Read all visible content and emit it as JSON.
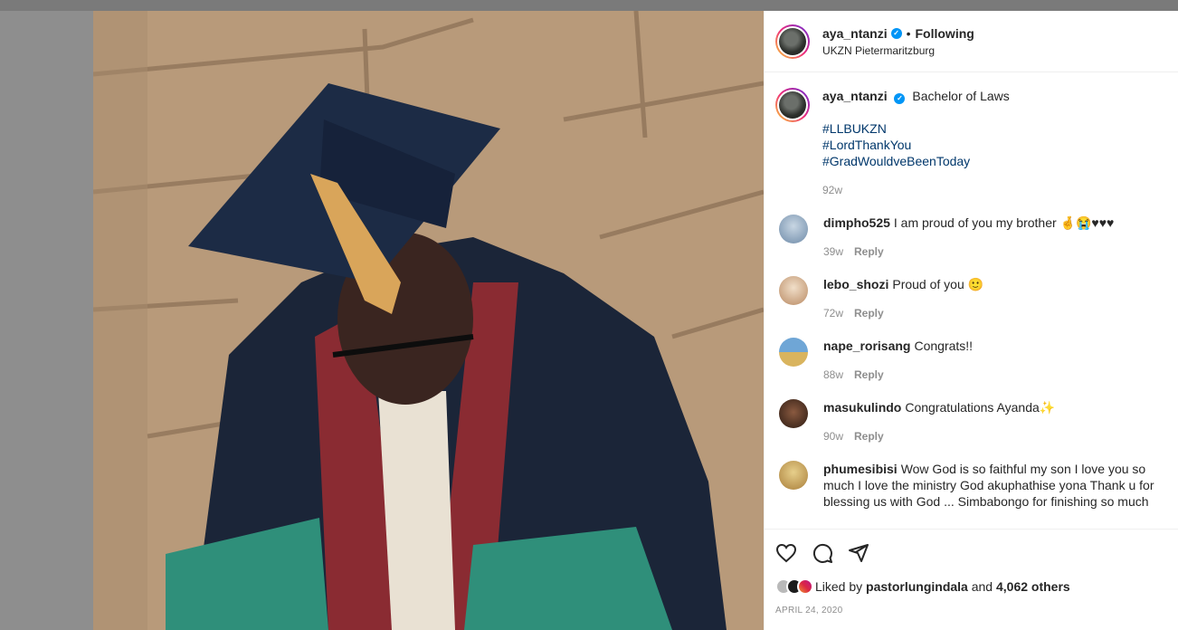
{
  "post": {
    "username": "aya_ntanzi",
    "verified_badge": "✓",
    "dot": "•",
    "follow_status": "Following",
    "location": "UKZN Pietermaritzburg"
  },
  "caption": {
    "username": "aya_ntanzi",
    "text": "Bachelor of Laws",
    "hashtags": [
      "#LLBUKZN",
      "#LordThankYou",
      "#GradWouldveBeenToday"
    ],
    "time": "92w"
  },
  "comments": [
    {
      "user": "dimpho525",
      "text": "I am proud of you my brother 🤞😭♥♥♥",
      "time": "39w",
      "reply": "Reply",
      "avatar_color": "#9db3c9"
    },
    {
      "user": "lebo_shozi",
      "text": "Proud of you 🙂",
      "time": "72w",
      "reply": "Reply",
      "avatar_color": "#d9b08c"
    },
    {
      "user": "nape_rorisang",
      "text": "Congrats!!",
      "time": "88w",
      "reply": "Reply",
      "avatar_color": "#4f86b8"
    },
    {
      "user": "masukulindo",
      "text": "Congratulations Ayanda✨",
      "time": "90w",
      "reply": "Reply",
      "avatar_color": "#5a3b2a"
    },
    {
      "user": "phumesibisi",
      "text": "Wow God is so faithful my son I love you so much I love the ministry God akuphathise yona Thank u for blessing us with God ... Simbabongo for finishing so much",
      "time": "",
      "reply": "",
      "avatar_color": "#c7a24a"
    }
  ],
  "likes": {
    "prefix": "Liked by",
    "user": "pastorlungindala",
    "and": "and",
    "others": "4,062 others"
  },
  "date": "APRIL 24, 2020",
  "icons": [
    "heart-icon",
    "comment-icon",
    "share-icon"
  ],
  "colors": {
    "link": "#00376b",
    "verified": "#0095f6",
    "muted": "#8e8e8e"
  }
}
